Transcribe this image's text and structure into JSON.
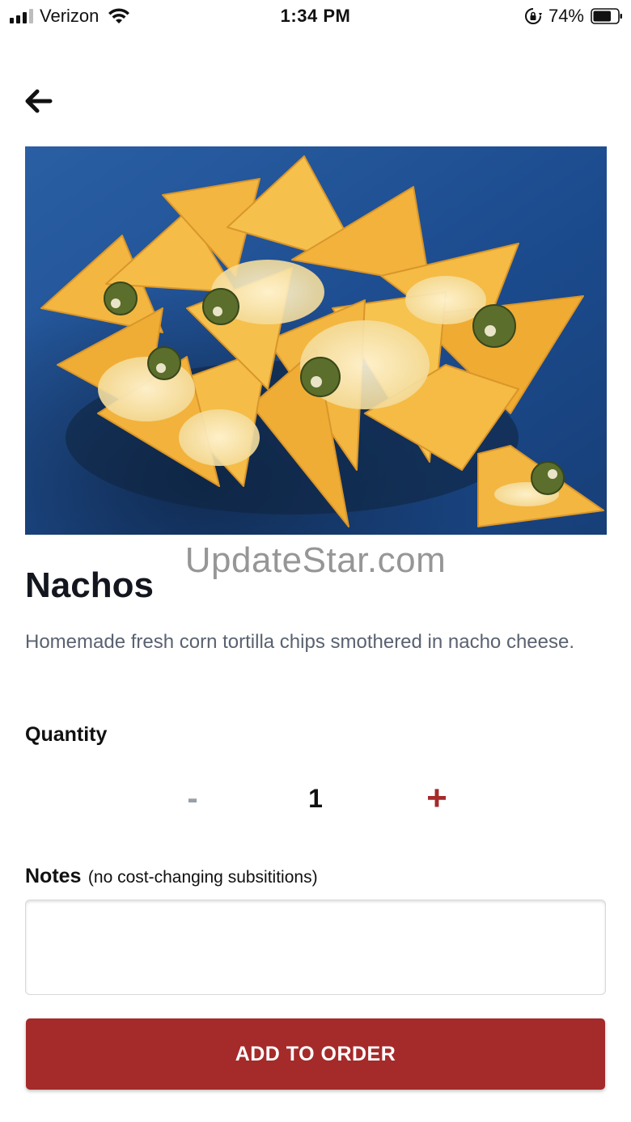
{
  "status_bar": {
    "carrier": "Verizon",
    "time": "1:34 PM",
    "battery_percent": "74%",
    "battery_level": 0.74,
    "icons": [
      "signal-icon",
      "wifi-icon",
      "rotation-lock-icon",
      "battery-icon"
    ]
  },
  "navigation": {
    "back_icon": "arrow-left-icon"
  },
  "item": {
    "image_subject": "plate of nachos with melted cheese and jalapenos",
    "watermark": "UpdateStar.com",
    "title": "Nachos",
    "description": "Homemade fresh corn tortilla chips smothered in nacho cheese."
  },
  "quantity": {
    "label": "Quantity",
    "minus_label": "-",
    "value": "1",
    "plus_label": "+"
  },
  "notes": {
    "label": "Notes",
    "hint": "(no cost-changing subsititions)",
    "value": "",
    "placeholder": ""
  },
  "actions": {
    "add_label": "ADD TO ORDER"
  },
  "colors": {
    "accent": "#a52a2a",
    "minus_disabled": "#9aa0a8",
    "description_text": "#5a6270",
    "image_background": "#1f4f8f",
    "chip": "#f2b43c"
  }
}
